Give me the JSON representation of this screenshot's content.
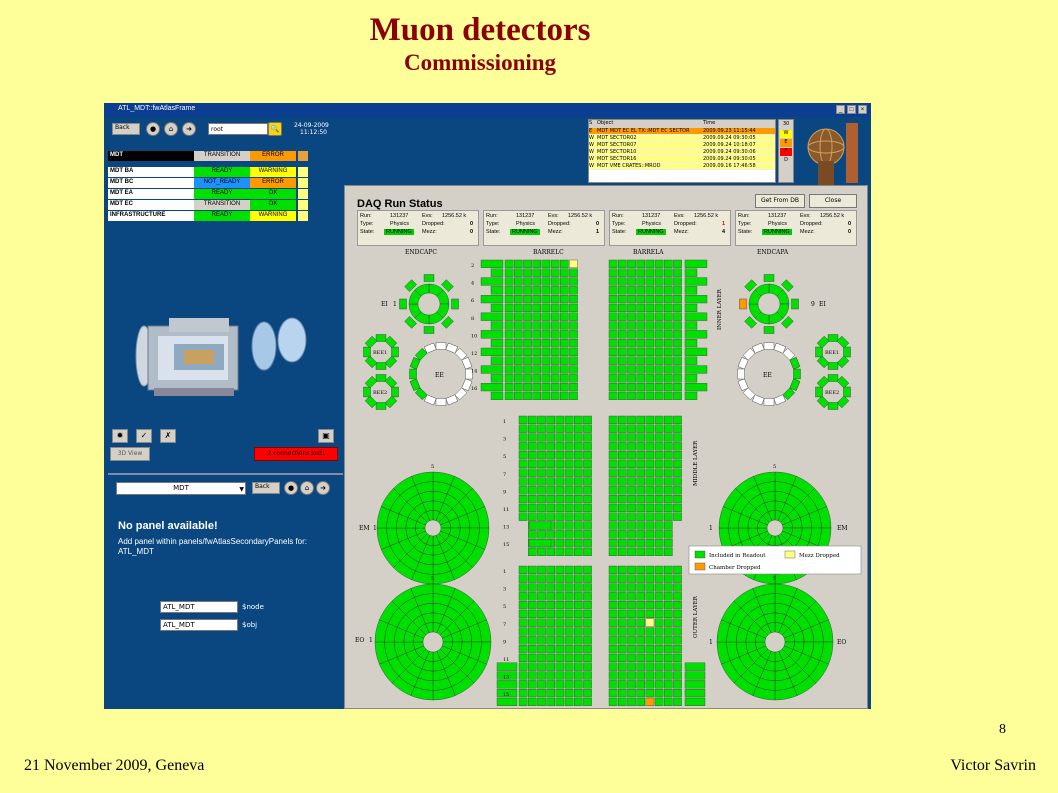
{
  "slide": {
    "title": "Muon detectors",
    "subtitle": "Commissioning",
    "page_number": "8",
    "footer_left": "21 November  2009, Geneva",
    "footer_right": "Victor Savrin"
  },
  "window": {
    "title": "ATL_MDT::fwAtlasFrame",
    "buttons": [
      "_",
      "□",
      "×"
    ]
  },
  "nav": {
    "back": "Back",
    "root_value": "root",
    "date": "24-09-2009",
    "time": "11:12:50"
  },
  "status_table": {
    "header": {
      "name": "MDT",
      "state": "TRANSITION",
      "alarm": "ERROR"
    },
    "rows": [
      {
        "name": "MDT BA",
        "state": "READY",
        "alarm": "WARNING",
        "state_color": "#00e000",
        "alarm_color": "#ffff00"
      },
      {
        "name": "MDT BC",
        "state": "NOT_READY",
        "alarm": "ERROR",
        "state_color": "#1e90ff",
        "alarm_color": "#ff9900"
      },
      {
        "name": "MDT EA",
        "state": "READY",
        "alarm": "OK",
        "state_color": "#00e000",
        "alarm_color": "#00e000"
      },
      {
        "name": "MDT EC",
        "state": "TRANSITION",
        "alarm": "OK",
        "state_color": "#d4d0c8",
        "alarm_color": "#00e000"
      },
      {
        "name": "INFRASTRUCTURE",
        "state": "READY",
        "alarm": "WARNING",
        "state_color": "#00e000",
        "alarm_color": "#ffff00"
      }
    ]
  },
  "toolbar": {
    "view3d_label": "3D View",
    "connections_label": "2 connections lost!"
  },
  "lower_panel": {
    "select_value": "MDT",
    "back": "Back",
    "no_panel_title": "No panel available!",
    "no_panel_desc": "Add panel within panels/fwAtlasSecondaryPanels for: ATL_MDT",
    "node_value": "ATL_MDT",
    "node_label": "$node",
    "obj_value": "ATL_MDT",
    "obj_label": "$obj"
  },
  "event_list": {
    "headers": [
      "S",
      "Object",
      "Time"
    ],
    "rows": [
      {
        "s": "E",
        "object": "MDT MDT EC EL TX::MDT EC SECTOR",
        "time": "2009.09.23 11:15:44",
        "selected": true
      },
      {
        "s": "W",
        "object": "MDT SECTOR02",
        "time": "2009.09.24 09:30:05",
        "selected": false
      },
      {
        "s": "W",
        "object": "MDT SECTOR07",
        "time": "2009.09.24 10:18:07",
        "selected": false
      },
      {
        "s": "W",
        "object": "MDT SECTOR10",
        "time": "2009.09.24 09:30:06",
        "selected": false
      },
      {
        "s": "W",
        "object": "MDT SECTOR16",
        "time": "2009.09.24 09:30:05",
        "selected": false
      },
      {
        "s": "W",
        "object": "MDT VME CRATES::MROD",
        "time": "2009.09.16 17:46:58",
        "selected": false
      }
    ],
    "alarm_counts": [
      {
        "label": "30",
        "color": "#d4d0c8"
      },
      {
        "label": "W",
        "color": "#ffff00"
      },
      {
        "label": "E",
        "color": "#ff9900"
      },
      {
        "label": "F",
        "color": "#ff0000"
      },
      {
        "label": "D",
        "color": "#d4d0c8"
      }
    ]
  },
  "daq": {
    "title": "DAQ Run Status",
    "get_from_db": "Get From DB",
    "close": "Close",
    "boxes": [
      {
        "run": "131237",
        "evs": "1256.52 k",
        "type": "Physics",
        "dropped": "0",
        "state": "RUNNING",
        "mezz": "0"
      },
      {
        "run": "131237",
        "evs": "1256.52 k",
        "type": "Physics",
        "dropped": "0",
        "state": "RUNNING",
        "mezz": "1"
      },
      {
        "run": "131237",
        "evs": "1256.52 k",
        "type": "Physics",
        "dropped": "1",
        "state": "RUNNING",
        "mezz": "4"
      },
      {
        "run": "131237",
        "evs": "1256.52 k",
        "type": "Physics",
        "dropped": "0",
        "state": "RUNNING",
        "mezz": "0"
      }
    ],
    "labels": {
      "run": "Run:",
      "evs": "Evs:",
      "type": "Type:",
      "dropped": "Dropped:",
      "state": "State:",
      "mezz": "Mezz:"
    },
    "sections": {
      "endcapc": "ENDCAPC",
      "barrelc": "BARRELC",
      "barrela": "BARRELA",
      "endcapa": "ENDCAPA",
      "inner": "INNER LAYER",
      "middle": "MIDDLE LAYER",
      "outer": "OUTER LAYER",
      "ei": "EI",
      "ee": "EE",
      "bee1": "BEE1",
      "bee2": "BEE2",
      "em": "EM",
      "eo": "EO",
      "ei_c_num": "1",
      "ei_a_num": "9",
      "em_c_num": "1",
      "em_a_num": "1",
      "eo_c_num": "1",
      "eo_a_num": "1",
      "top_num": "5"
    },
    "inner_rows": [
      "2",
      "4",
      "6",
      "8",
      "10",
      "12",
      "14",
      "16"
    ],
    "middle_rows": [
      "1",
      "3",
      "5",
      "7",
      "9",
      "11",
      "13",
      "15"
    ],
    "outer_rows": [
      "1",
      "3",
      "5",
      "7",
      "9",
      "11",
      "13",
      "15"
    ],
    "legend": {
      "included": "Included in Readout",
      "mezz": "Mezz Dropped",
      "chamber": "Chamber Dropped"
    },
    "colors": {
      "included": "#00e000",
      "mezz": "#ffff80",
      "chamber": "#ff9900",
      "empty": "#ffffff"
    }
  }
}
